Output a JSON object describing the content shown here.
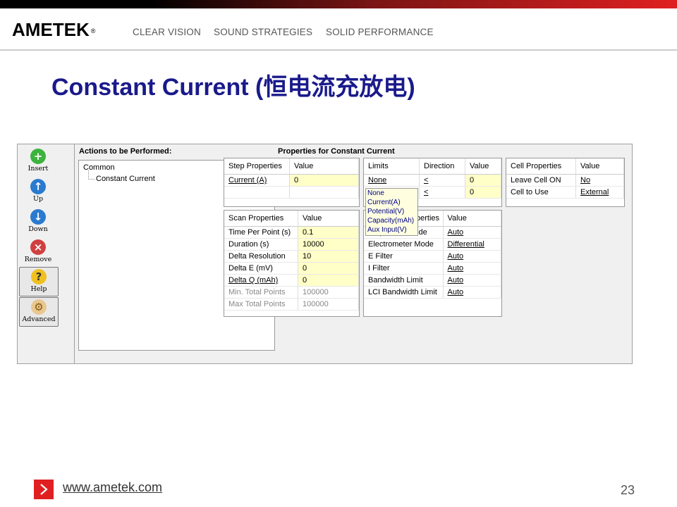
{
  "header": {
    "logo_text": "AMETEK",
    "logo_mark": "®",
    "taglines": [
      "CLEAR VISION",
      "SOUND STRATEGIES",
      "SOLID PERFORMANCE"
    ]
  },
  "slide_title": "Constant Current (恒电流充放电)",
  "app": {
    "toolbar": {
      "insert": "Insert",
      "up": "Up",
      "down": "Down",
      "remove": "Remove",
      "help": "Help",
      "advanced": "Advanced"
    },
    "actions_header": "Actions to be Performed:",
    "properties_header": "Properties for Constant Current",
    "tree": {
      "root": "Common",
      "child": "Constant Current"
    },
    "step_props": {
      "col1": "Step Properties",
      "col2": "Value",
      "rows": [
        {
          "name": "Current (A)",
          "value": "0"
        }
      ]
    },
    "limits": {
      "col1": "Limits",
      "col2": "Direction",
      "col3": "Value",
      "rows": [
        {
          "name": "None",
          "direction": "<",
          "value": "0"
        },
        {
          "name": "",
          "direction": "<",
          "value": "0"
        }
      ]
    },
    "limits_dropdown": [
      "None",
      "Current(A)",
      "Potential(V)",
      "Capacity(mAh)",
      "Aux Input(V)"
    ],
    "cell_props": {
      "col1": "Cell Properties",
      "col2": "Value",
      "rows": [
        {
          "name": "Leave Cell ON",
          "value": "No"
        },
        {
          "name": "Cell to Use",
          "value": "External"
        }
      ]
    },
    "scan_props": {
      "col1": "Scan Properties",
      "col2": "Value",
      "rows": [
        {
          "name": "Time Per Point (s)",
          "value": "0.1"
        },
        {
          "name": "Duration (s)",
          "value": "10000"
        },
        {
          "name": "Delta Resolution",
          "value": "10"
        },
        {
          "name": "Delta E (mV)",
          "value": "0"
        },
        {
          "name": "Delta Q (mAh)",
          "value": "0"
        },
        {
          "name": "Min. Total Points",
          "value": "100000"
        },
        {
          "name": "Max Total Points",
          "value": "100000"
        }
      ]
    },
    "inst_props": {
      "col1_partial": "perties",
      "col2": "Value",
      "rows": [
        {
          "name": "Acquisition Mode",
          "value": "Auto"
        },
        {
          "name": "Electrometer Mode",
          "value": "Differential"
        },
        {
          "name": "E Filter",
          "value": "Auto"
        },
        {
          "name": "I Filter",
          "value": "Auto"
        },
        {
          "name": "Bandwidth Limit",
          "value": "Auto"
        },
        {
          "name": "LCI Bandwidth Limit",
          "value": "Auto"
        }
      ]
    }
  },
  "footer": {
    "url": "www.ametek.com",
    "page": "23"
  },
  "colors": {
    "title": "#1a1a8c",
    "accent_red": "#e02020",
    "cell_yellow": "#ffffc8"
  }
}
